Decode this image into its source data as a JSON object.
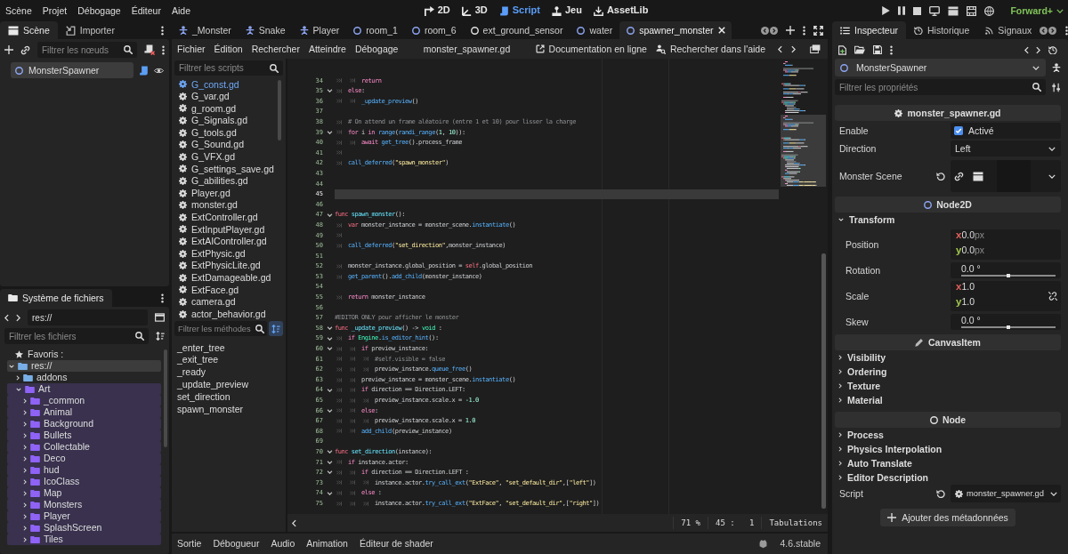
{
  "menu_bar": {
    "menus": [
      "Scène",
      "Projet",
      "Débogage",
      "Éditeur",
      "Aide"
    ],
    "workspaces": [
      {
        "label": "2D",
        "kind": "canvas",
        "selected": false
      },
      {
        "label": "3D",
        "kind": "spatial",
        "selected": false
      },
      {
        "label": "Script",
        "kind": "script",
        "selected": true
      },
      {
        "label": "Jeu",
        "kind": "game",
        "selected": false
      },
      {
        "label": "AssetLib",
        "kind": "assetlib",
        "selected": false
      }
    ],
    "renderer": "Forward+"
  },
  "scene_dock": {
    "tabs": [
      {
        "label": "Scène",
        "kind": "scene",
        "selected": true
      },
      {
        "label": "Importer",
        "kind": "import",
        "selected": false
      }
    ],
    "filter": {
      "placeholder": "Filtrer les nœuds"
    },
    "tree": [
      {
        "label": "MonsterSpawner",
        "selected": true
      }
    ]
  },
  "filesystem_dock": {
    "tabs": [
      {
        "label": "Système de fichiers",
        "kind": "files",
        "selected": true
      }
    ],
    "path": "res://",
    "filter": {
      "placeholder": "Filtrer les fichiers"
    },
    "favorites": "Favoris :",
    "tree": [
      {
        "label": "res://",
        "selected": true,
        "expanded": true,
        "children": [
          {
            "label": "addons",
            "selected": false,
            "expanded": false
          },
          {
            "label": "Art",
            "color": "#8e63f5",
            "selected": false,
            "expanded": true,
            "children": [
              {
                "label": "_common",
                "color": "#8e63f5",
                "selected": false,
                "expanded": false
              },
              {
                "label": "Animal",
                "color": "#8e63f5",
                "selected": false,
                "expanded": false
              },
              {
                "label": "Background",
                "color": "#8e63f5",
                "selected": false,
                "expanded": false
              },
              {
                "label": "Bullets",
                "color": "#8e63f5",
                "selected": false,
                "expanded": false
              },
              {
                "label": "Collectable",
                "color": "#8e63f5",
                "selected": false,
                "expanded": false
              },
              {
                "label": "Deco",
                "color": "#8e63f5",
                "selected": false,
                "expanded": false
              },
              {
                "label": "hud",
                "color": "#8e63f5",
                "selected": false,
                "expanded": false
              },
              {
                "label": "IcoClass",
                "color": "#8e63f5",
                "selected": false,
                "expanded": false
              },
              {
                "label": "Map",
                "color": "#8e63f5",
                "selected": false,
                "expanded": false
              },
              {
                "label": "Monsters",
                "color": "#8e63f5",
                "selected": false,
                "expanded": false
              },
              {
                "label": "Player",
                "color": "#8e63f5",
                "selected": false,
                "expanded": false
              },
              {
                "label": "SplashScreen",
                "color": "#8e63f5",
                "selected": false,
                "expanded": false
              },
              {
                "label": "Tiles",
                "color": "#8e63f5",
                "selected": false,
                "expanded": false
              }
            ]
          }
        ]
      }
    ]
  },
  "script_editor": {
    "tabs": [
      {
        "label": "_Monster",
        "kind": "scene",
        "color": "#8da5f3",
        "selected": false
      },
      {
        "label": "Snake",
        "kind": "scene",
        "color": "#8da5f3",
        "selected": false
      },
      {
        "label": "Player",
        "kind": "scene",
        "color": "#8da5f3",
        "selected": false
      },
      {
        "label": "room_1",
        "kind": "node",
        "color": "#8da5f3",
        "selected": false
      },
      {
        "label": "room_6",
        "kind": "node",
        "color": "#8da5f3",
        "selected": false
      },
      {
        "label": "ext_ground_sensor",
        "kind": "node",
        "color": "#e0e0e0",
        "selected": false
      },
      {
        "label": "water",
        "kind": "node",
        "color": "#8da5f3",
        "selected": false
      },
      {
        "label": "spawner_monster",
        "kind": "node",
        "color": "#8da5f3",
        "selected": true
      }
    ],
    "menus": [
      "Fichier",
      "Édition",
      "Rechercher",
      "Atteindre",
      "Débogage"
    ],
    "title": "monster_spawner.gd",
    "help": [
      {
        "label": "Documentation en ligne",
        "kind": "docs"
      },
      {
        "label": "Rechercher dans l'aide",
        "kind": "searchhelp"
      }
    ],
    "script_filter": {
      "placeholder": "Filtrer les scripts"
    },
    "scripts": [
      {
        "label": "G_const.gd",
        "selected": true
      },
      {
        "label": "G_var.gd",
        "selected": false
      },
      {
        "label": "g_room.gd",
        "selected": false
      },
      {
        "label": "G_Signals.gd",
        "selected": false
      },
      {
        "label": "G_tools.gd",
        "selected": false
      },
      {
        "label": "G_Sound.gd",
        "selected": false
      },
      {
        "label": "G_VFX.gd",
        "selected": false
      },
      {
        "label": "G_settings_save.gd",
        "selected": false
      },
      {
        "label": "G_abilities.gd",
        "selected": false
      },
      {
        "label": "Player.gd",
        "selected": false
      },
      {
        "label": "monster.gd",
        "selected": false
      },
      {
        "label": "ExtController.gd",
        "selected": false
      },
      {
        "label": "ExtInputPlayer.gd",
        "selected": false
      },
      {
        "label": "ExtAIController.gd",
        "selected": false
      },
      {
        "label": "ExtPhysic.gd",
        "selected": false
      },
      {
        "label": "ExtPhysicLite.gd",
        "selected": false
      },
      {
        "label": "ExtDamageable.gd",
        "selected": false
      },
      {
        "label": "ExtFace.gd",
        "selected": false
      },
      {
        "label": "camera.gd",
        "selected": false
      },
      {
        "label": "actor_behavior.gd",
        "selected": false
      }
    ],
    "method_filter": {
      "placeholder": "Filtrer les méthodes"
    },
    "method_sort": {
      "on": true
    },
    "methods": [
      {
        "label": "_enter_tree",
        "selected": false
      },
      {
        "label": "_exit_tree",
        "selected": false
      },
      {
        "label": "_ready",
        "selected": false
      },
      {
        "label": "_update_preview",
        "selected": false
      },
      {
        "label": "set_direction",
        "selected": false
      },
      {
        "label": "spawn_monster",
        "selected": false
      }
    ],
    "code": {
      "lines": [
        {
          "number": "34",
          "foldable": false,
          "current": false,
          "segments": [
            {
              "kind": "tab"
            },
            {
              "kind": "tab"
            },
            {
              "kind": "control",
              "text": "return"
            }
          ]
        },
        {
          "number": "35",
          "foldable": true,
          "current": false,
          "segments": [
            {
              "kind": "tab"
            },
            {
              "kind": "control",
              "text": "else"
            },
            {
              "kind": "plain",
              "text": ":"
            }
          ]
        },
        {
          "number": "36",
          "foldable": false,
          "current": false,
          "segments": [
            {
              "kind": "tab"
            },
            {
              "kind": "tab"
            },
            {
              "kind": "call",
              "text": "_update_preview"
            },
            {
              "kind": "plain",
              "text": "()"
            }
          ]
        },
        {
          "number": "37",
          "foldable": false,
          "current": false
        },
        {
          "number": "38",
          "foldable": false,
          "current": false,
          "segments": [
            {
              "kind": "tab"
            },
            {
              "kind": "comment",
              "text": "# On attend un frame aléatoire (entre 1 et 10) pour lisser la charge"
            }
          ]
        },
        {
          "number": "39",
          "foldable": true,
          "current": false,
          "segments": [
            {
              "kind": "tab"
            },
            {
              "kind": "control",
              "text": "for"
            },
            {
              "kind": "plain",
              "text": " i "
            },
            {
              "kind": "control",
              "text": "in "
            },
            {
              "kind": "call",
              "text": "range"
            },
            {
              "kind": "plain",
              "text": "("
            },
            {
              "kind": "call",
              "text": "randi_range"
            },
            {
              "kind": "plain",
              "text": "("
            },
            {
              "kind": "number",
              "text": "1"
            },
            {
              "kind": "plain",
              "text": ", "
            },
            {
              "kind": "number",
              "text": "10"
            },
            {
              "kind": "plain",
              "text": ")):"
            }
          ]
        },
        {
          "number": "40",
          "foldable": false,
          "current": false,
          "segments": [
            {
              "kind": "tab"
            },
            {
              "kind": "tab"
            },
            {
              "kind": "control",
              "text": "await "
            },
            {
              "kind": "call",
              "text": "get_tree"
            },
            {
              "kind": "plain",
              "text": "().process_frame"
            }
          ]
        },
        {
          "number": "41",
          "foldable": false,
          "current": false,
          "segments": [
            {
              "kind": "tab"
            }
          ]
        },
        {
          "number": "42",
          "foldable": false,
          "current": false,
          "segments": [
            {
              "kind": "tab"
            },
            {
              "kind": "call",
              "text": "call_deferred"
            },
            {
              "kind": "plain",
              "text": "("
            },
            {
              "kind": "string",
              "text": "\"spawn_monster\""
            },
            {
              "kind": "plain",
              "text": ")"
            }
          ]
        },
        {
          "number": "43",
          "foldable": false,
          "current": false
        },
        {
          "number": "44",
          "foldable": false,
          "current": false
        },
        {
          "number": "45",
          "foldable": false,
          "current": true
        },
        {
          "number": "46",
          "foldable": false,
          "current": false
        },
        {
          "number": "47",
          "foldable": true,
          "current": false,
          "segments": [
            {
              "kind": "keyword",
              "text": "func "
            },
            {
              "kind": "def",
              "text": "spawn_monster"
            },
            {
              "kind": "plain",
              "text": "():"
            }
          ]
        },
        {
          "number": "48",
          "foldable": false,
          "current": false,
          "segments": [
            {
              "kind": "tab"
            },
            {
              "kind": "keyword",
              "text": "var"
            },
            {
              "kind": "plain",
              "text": " monster_instance = monster_scene."
            },
            {
              "kind": "call",
              "text": "instantiate"
            },
            {
              "kind": "plain",
              "text": "()"
            }
          ]
        },
        {
          "number": "49",
          "foldable": false,
          "current": false,
          "segments": [
            {
              "kind": "tab"
            }
          ]
        },
        {
          "number": "50",
          "foldable": false,
          "current": false,
          "segments": [
            {
              "kind": "tab"
            },
            {
              "kind": "call",
              "text": "call_deferred"
            },
            {
              "kind": "plain",
              "text": "("
            },
            {
              "kind": "string",
              "text": "\"set_direction\""
            },
            {
              "kind": "plain",
              "text": ",monster_instance)"
            }
          ]
        },
        {
          "number": "51",
          "foldable": false,
          "current": false
        },
        {
          "number": "52",
          "foldable": false,
          "current": false,
          "segments": [
            {
              "kind": "tab"
            },
            {
              "kind": "plain",
              "text": "monster_instance.global_position = "
            },
            {
              "kind": "keyword",
              "text": "self"
            },
            {
              "kind": "plain",
              "text": ".global_position"
            }
          ]
        },
        {
          "number": "53",
          "foldable": false,
          "current": false,
          "segments": [
            {
              "kind": "tab"
            },
            {
              "kind": "call",
              "text": "get_parent"
            },
            {
              "kind": "plain",
              "text": "()."
            },
            {
              "kind": "call",
              "text": "add_child"
            },
            {
              "kind": "plain",
              "text": "(monster_instance)"
            }
          ]
        },
        {
          "number": "54",
          "foldable": false,
          "current": false
        },
        {
          "number": "55",
          "foldable": false,
          "current": false,
          "segments": [
            {
              "kind": "tab"
            },
            {
              "kind": "control",
              "text": "return"
            },
            {
              "kind": "plain",
              "text": " monster_instance"
            }
          ]
        },
        {
          "number": "56",
          "foldable": false,
          "current": false
        },
        {
          "number": "57",
          "foldable": false,
          "current": false,
          "segments": [
            {
              "kind": "comment",
              "text": "#EDITOR ONLY pour afficher le monster"
            }
          ]
        },
        {
          "number": "58",
          "foldable": true,
          "current": false,
          "segments": [
            {
              "kind": "keyword",
              "text": "func "
            },
            {
              "kind": "def",
              "text": "_update_preview"
            },
            {
              "kind": "plain",
              "text": "() -> "
            },
            {
              "kind": "type",
              "text": "void"
            },
            {
              "kind": "plain",
              "text": " :"
            }
          ]
        },
        {
          "number": "59",
          "foldable": true,
          "current": false,
          "segments": [
            {
              "kind": "tab"
            },
            {
              "kind": "control",
              "text": "if "
            },
            {
              "kind": "type",
              "text": "Engine"
            },
            {
              "kind": "plain",
              "text": "."
            },
            {
              "kind": "call",
              "text": "is_editor_hint"
            },
            {
              "kind": "plain",
              "text": "():"
            }
          ]
        },
        {
          "number": "60",
          "foldable": true,
          "current": false,
          "segments": [
            {
              "kind": "tab"
            },
            {
              "kind": "tab"
            },
            {
              "kind": "control",
              "text": "if"
            },
            {
              "kind": "plain",
              "text": " preview_instance:"
            }
          ]
        },
        {
          "number": "61",
          "foldable": false,
          "current": false,
          "segments": [
            {
              "kind": "tab"
            },
            {
              "kind": "tab"
            },
            {
              "kind": "tab"
            },
            {
              "kind": "comment",
              "text": "#self.visible = false"
            }
          ]
        },
        {
          "number": "62",
          "foldable": false,
          "current": false,
          "segments": [
            {
              "kind": "tab"
            },
            {
              "kind": "tab"
            },
            {
              "kind": "tab"
            },
            {
              "kind": "plain",
              "text": "preview_instance."
            },
            {
              "kind": "call",
              "text": "queue_free"
            },
            {
              "kind": "plain",
              "text": "()"
            }
          ]
        },
        {
          "number": "63",
          "foldable": false,
          "current": false,
          "segments": [
            {
              "kind": "tab"
            },
            {
              "kind": "tab"
            },
            {
              "kind": "plain",
              "text": "preview_instance = monster_scene."
            },
            {
              "kind": "call",
              "text": "instantiate"
            },
            {
              "kind": "plain",
              "text": "()"
            }
          ]
        },
        {
          "number": "64",
          "foldable": true,
          "current": false,
          "segments": [
            {
              "kind": "tab"
            },
            {
              "kind": "tab"
            },
            {
              "kind": "control",
              "text": "if"
            },
            {
              "kind": "plain",
              "text": " direction == Direction.LEFT:"
            }
          ]
        },
        {
          "number": "65",
          "foldable": false,
          "current": false,
          "segments": [
            {
              "kind": "tab"
            },
            {
              "kind": "tab"
            },
            {
              "kind": "tab"
            },
            {
              "kind": "plain",
              "text": "preview_instance.scale.x = "
            },
            {
              "kind": "number",
              "text": "-1.0"
            }
          ]
        },
        {
          "number": "66",
          "foldable": true,
          "current": false,
          "segments": [
            {
              "kind": "tab"
            },
            {
              "kind": "tab"
            },
            {
              "kind": "control",
              "text": "else"
            },
            {
              "kind": "plain",
              "text": ":"
            }
          ]
        },
        {
          "number": "67",
          "foldable": false,
          "current": false,
          "segments": [
            {
              "kind": "tab"
            },
            {
              "kind": "tab"
            },
            {
              "kind": "tab"
            },
            {
              "kind": "plain",
              "text": "preview_instance.scale.x = "
            },
            {
              "kind": "number",
              "text": "1.0"
            }
          ]
        },
        {
          "number": "68",
          "foldable": false,
          "current": false,
          "segments": [
            {
              "kind": "tab"
            },
            {
              "kind": "tab"
            },
            {
              "kind": "call",
              "text": "add_child"
            },
            {
              "kind": "plain",
              "text": "(preview_instance)"
            }
          ]
        },
        {
          "number": "69",
          "foldable": false,
          "current": false
        },
        {
          "number": "70",
          "foldable": true,
          "current": false,
          "segments": [
            {
              "kind": "keyword",
              "text": "func "
            },
            {
              "kind": "def",
              "text": "set_direction"
            },
            {
              "kind": "plain",
              "text": "(instance):"
            }
          ]
        },
        {
          "number": "71",
          "foldable": true,
          "current": false,
          "segments": [
            {
              "kind": "tab"
            },
            {
              "kind": "control",
              "text": "if"
            },
            {
              "kind": "plain",
              "text": " instance.actor:"
            }
          ]
        },
        {
          "number": "72",
          "foldable": true,
          "current": false,
          "segments": [
            {
              "kind": "tab"
            },
            {
              "kind": "tab"
            },
            {
              "kind": "control",
              "text": "if"
            },
            {
              "kind": "plain",
              "text": " direction == Direction.LEFT :"
            }
          ]
        },
        {
          "number": "73",
          "foldable": false,
          "current": false,
          "segments": [
            {
              "kind": "tab"
            },
            {
              "kind": "tab"
            },
            {
              "kind": "tab"
            },
            {
              "kind": "plain",
              "text": "instance.actor."
            },
            {
              "kind": "call",
              "text": "try_call_ext"
            },
            {
              "kind": "plain",
              "text": "("
            },
            {
              "kind": "string",
              "text": "\"ExtFace\""
            },
            {
              "kind": "plain",
              "text": ", "
            },
            {
              "kind": "string",
              "text": "\"set_default_dir\""
            },
            {
              "kind": "plain",
              "text": ",["
            },
            {
              "kind": "string",
              "text": "\"left\""
            },
            {
              "kind": "plain",
              "text": "])"
            }
          ]
        },
        {
          "number": "74",
          "foldable": true,
          "current": false,
          "segments": [
            {
              "kind": "tab"
            },
            {
              "kind": "tab"
            },
            {
              "kind": "control",
              "text": "else"
            },
            {
              "kind": "plain",
              "text": " :"
            }
          ]
        },
        {
          "number": "75",
          "foldable": false,
          "current": false,
          "segments": [
            {
              "kind": "tab"
            },
            {
              "kind": "tab"
            },
            {
              "kind": "tab"
            },
            {
              "kind": "plain",
              "text": "instance.actor."
            },
            {
              "kind": "call",
              "text": "try_call_ext"
            },
            {
              "kind": "plain",
              "text": "("
            },
            {
              "kind": "string",
              "text": "\"ExtFace\""
            },
            {
              "kind": "plain",
              "text": ", "
            },
            {
              "kind": "string",
              "text": "\"set_default_dir\""
            },
            {
              "kind": "plain",
              "text": ",["
            },
            {
              "kind": "string",
              "text": "\"right\""
            },
            {
              "kind": "plain",
              "text": "])"
            }
          ]
        }
      ]
    },
    "status": {
      "zoom": "71 %",
      "position": "45 :   1",
      "indentation": "Tabulations"
    }
  },
  "bottom_panel": {
    "tabs": [
      {
        "label": "Sortie",
        "selected": false
      },
      {
        "label": "Débogueur",
        "selected": false
      },
      {
        "label": "Audio",
        "selected": false
      },
      {
        "label": "Animation",
        "selected": false
      },
      {
        "label": "Éditeur de shader",
        "selected": false
      }
    ],
    "version": "4.6.stable"
  },
  "inspector": {
    "tabs": [
      {
        "label": "Inspecteur",
        "kind": "inspector",
        "selected": true
      },
      {
        "label": "Historique",
        "kind": "history",
        "selected": false
      },
      {
        "label": "Signaux",
        "kind": "signals",
        "selected": false
      }
    ],
    "object": "MonsterSpawner",
    "filter": {
      "placeholder": "Filtrer les propriétés"
    },
    "sections": [
      {
        "title": "monster_spawner.gd",
        "kind": "script",
        "items": [
          {
            "kind": "check",
            "label": "Enable",
            "checked": true,
            "text": "Activé"
          },
          {
            "kind": "select",
            "label": "Direction",
            "value": "Left"
          },
          {
            "kind": "resource",
            "label": "Monster Scene"
          }
        ]
      },
      {
        "title": "Node2D",
        "kind": "node2d",
        "items": [
          {
            "kind": "group",
            "label": "Transform",
            "expanded": true,
            "children": [
              {
                "kind": "vector",
                "label": "Position",
                "components": [
                  {
                    "axis": "x",
                    "value": "0.0",
                    "unit": "px",
                    "color": "#e0605a"
                  },
                  {
                    "axis": "y",
                    "value": "0.0",
                    "unit": "px",
                    "color": "#a3c94e"
                  }
                ]
              },
              {
                "kind": "slider",
                "label": "Rotation",
                "value": "0.0 °",
                "level": 0.5
              },
              {
                "kind": "linkedvector",
                "label": "Scale",
                "components": [
                  {
                    "axis": "x",
                    "value": "1.0",
                    "color": "#e0605a"
                  },
                  {
                    "axis": "y",
                    "value": "1.0",
                    "color": "#a3c94e"
                  }
                ]
              },
              {
                "kind": "slider",
                "label": "Skew",
                "value": "0.0 °",
                "level": 0.5
              }
            ]
          }
        ]
      },
      {
        "title": "CanvasItem",
        "kind": "canvasitem",
        "items": [
          {
            "kind": "group",
            "label": "Visibility",
            "expanded": false
          },
          {
            "kind": "group",
            "label": "Ordering",
            "expanded": false
          },
          {
            "kind": "group",
            "label": "Texture",
            "expanded": false
          },
          {
            "kind": "group",
            "label": "Material",
            "expanded": false
          }
        ]
      },
      {
        "title": "Node",
        "kind": "node",
        "items": [
          {
            "kind": "group",
            "label": "Process",
            "expanded": false
          },
          {
            "kind": "group",
            "label": "Physics Interpolation",
            "expanded": false
          },
          {
            "kind": "group",
            "label": "Auto Translate",
            "expanded": false
          },
          {
            "kind": "group",
            "label": "Editor Description",
            "expanded": false
          },
          {
            "kind": "script",
            "label": "Script",
            "value": "monster_spawner.gd"
          }
        ]
      }
    ],
    "add_button": "Ajouter des métadonnées"
  }
}
